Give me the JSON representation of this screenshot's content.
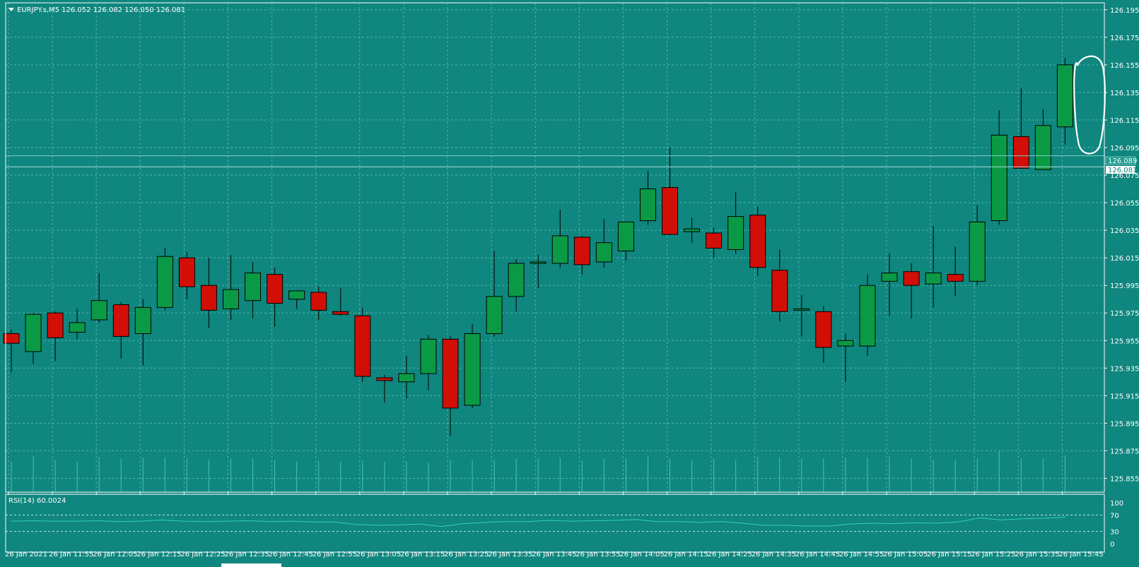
{
  "header": {
    "symbol_line": "EURJPY.s,M5  126.052 126.082 126.050 126.081"
  },
  "rsi_panel": {
    "label": "RSI(14) 60.0024",
    "levels": [
      "100",
      "70",
      "30",
      "0"
    ]
  },
  "price_tags": {
    "bid": "126.081",
    "ask": "126.089"
  },
  "colors": {
    "background": "#0f867e",
    "grid": "#4fb5ad",
    "bull": "#0a9a45",
    "bear": "#d10f06",
    "text": "#ffffff",
    "annotation": "#ffffff"
  },
  "chart_data": {
    "type": "candlestick",
    "symbol": "EURJPY.s",
    "timeframe": "M5",
    "ylim": [
      125.845,
      126.2
    ],
    "y_ticks": [
      "126.195",
      "126.175",
      "126.155",
      "126.135",
      "126.115",
      "126.095",
      "126.075",
      "126.055",
      "126.035",
      "126.015",
      "125.995",
      "125.975",
      "125.955",
      "125.935",
      "125.915",
      "125.895",
      "125.875",
      "125.855"
    ],
    "x_labels": [
      "26 Jan 2021",
      "26 Jan 11:55",
      "26 Jan 12:05",
      "26 Jan 12:15",
      "26 Jan 12:25",
      "26 Jan 12:35",
      "26 Jan 12:45",
      "26 Jan 12:55",
      "26 Jan 13:05",
      "26 Jan 13:15",
      "26 Jan 13:25",
      "26 Jan 13:35",
      "26 Jan 13:45",
      "26 Jan 13:55",
      "26 Jan 14:05",
      "26 Jan 14:15",
      "26 Jan 14:25",
      "26 Jan 14:35",
      "26 Jan 14:45",
      "26 Jan 14:55",
      "26 Jan 15:05",
      "26 Jan 15:15",
      "26 Jan 15:25",
      "26 Jan 15:35",
      "26 Jan 15:45"
    ],
    "candles": [
      [
        125.96,
        125.963,
        125.932,
        125.953
      ],
      [
        125.947,
        125.975,
        125.938,
        125.974
      ],
      [
        125.975,
        125.976,
        125.94,
        125.957
      ],
      [
        125.961,
        125.978,
        125.956,
        125.968
      ],
      [
        125.97,
        126.004,
        125.968,
        125.984
      ],
      [
        125.981,
        125.983,
        125.942,
        125.958
      ],
      [
        125.96,
        125.985,
        125.937,
        125.979
      ],
      [
        125.979,
        126.022,
        125.977,
        126.016
      ],
      [
        126.015,
        126.019,
        125.985,
        125.994
      ],
      [
        125.995,
        126.015,
        125.964,
        125.977
      ],
      [
        125.978,
        126.017,
        125.97,
        125.992
      ],
      [
        125.984,
        126.012,
        125.971,
        126.004
      ],
      [
        126.003,
        126.008,
        125.965,
        125.982
      ],
      [
        125.985,
        125.988,
        125.978,
        125.991
      ],
      [
        125.99,
        125.994,
        125.97,
        125.977
      ],
      [
        125.976,
        125.993,
        125.973,
        125.974
      ],
      [
        125.973,
        125.979,
        125.925,
        125.929
      ],
      [
        125.928,
        125.93,
        125.91,
        125.926
      ],
      [
        125.925,
        125.944,
        125.913,
        125.931
      ],
      [
        125.931,
        125.959,
        125.919,
        125.956
      ],
      [
        125.956,
        125.958,
        125.886,
        125.906
      ],
      [
        125.908,
        125.967,
        125.906,
        125.96
      ],
      [
        125.96,
        126.02,
        125.958,
        125.987
      ],
      [
        125.987,
        126.014,
        125.976,
        126.011
      ],
      [
        126.012,
        126.017,
        125.993,
        126.012
      ],
      [
        126.011,
        126.05,
        126.008,
        126.031
      ],
      [
        126.03,
        126.031,
        126.003,
        126.01
      ],
      [
        126.012,
        126.043,
        126.008,
        126.026
      ],
      [
        126.02,
        126.04,
        126.013,
        126.041
      ],
      [
        126.042,
        126.078,
        126.039,
        126.065
      ],
      [
        126.066,
        126.095,
        126.032,
        126.032
      ],
      [
        126.034,
        126.044,
        126.026,
        126.036
      ],
      [
        126.033,
        126.037,
        126.015,
        126.022
      ],
      [
        126.021,
        126.063,
        126.018,
        126.045
      ],
      [
        126.046,
        126.052,
        126.002,
        126.008
      ],
      [
        126.006,
        126.021,
        125.969,
        125.976
      ],
      [
        125.977,
        125.988,
        125.958,
        125.978
      ],
      [
        125.976,
        125.98,
        125.939,
        125.95
      ],
      [
        125.951,
        125.96,
        125.925,
        125.955
      ],
      [
        125.951,
        126.003,
        125.944,
        125.995
      ],
      [
        125.998,
        126.018,
        125.973,
        126.004
      ],
      [
        126.005,
        126.011,
        125.971,
        125.995
      ],
      [
        125.996,
        126.038,
        125.979,
        126.004
      ],
      [
        126.003,
        126.023,
        125.987,
        125.998
      ],
      [
        125.998,
        126.053,
        125.995,
        126.041
      ],
      [
        126.042,
        126.122,
        126.039,
        126.104
      ],
      [
        126.103,
        126.138,
        126.081,
        126.08
      ],
      [
        126.079,
        126.123,
        126.079,
        126.111
      ],
      [
        126.11,
        126.16,
        126.097,
        126.155
      ]
    ],
    "volumes": [
      0.3,
      0.35,
      0.32,
      0.3,
      0.35,
      0.33,
      0.34,
      0.34,
      0.33,
      0.32,
      0.33,
      0.33,
      0.32,
      0.3,
      0.31,
      0.3,
      0.31,
      0.3,
      0.3,
      0.29,
      0.32,
      0.31,
      0.32,
      0.33,
      0.33,
      0.34,
      0.31,
      0.33,
      0.33,
      0.35,
      0.33,
      0.32,
      0.33,
      0.32,
      0.35,
      0.34,
      0.33,
      0.33,
      0.34,
      0.34,
      0.35,
      0.33,
      0.32,
      0.32,
      0.33,
      0.4,
      0.33,
      0.33,
      0.36
    ],
    "rsi": [
      55,
      56,
      55,
      55,
      56,
      54,
      55,
      58,
      55,
      54,
      55,
      56,
      54,
      55,
      53,
      53,
      47,
      45,
      46,
      48,
      42,
      49,
      52,
      54,
      54,
      57,
      55,
      56,
      57,
      59,
      54,
      54,
      52,
      54,
      50,
      45,
      45,
      43,
      43,
      48,
      50,
      49,
      51,
      50,
      53,
      63,
      58,
      61,
      62,
      65
    ]
  }
}
